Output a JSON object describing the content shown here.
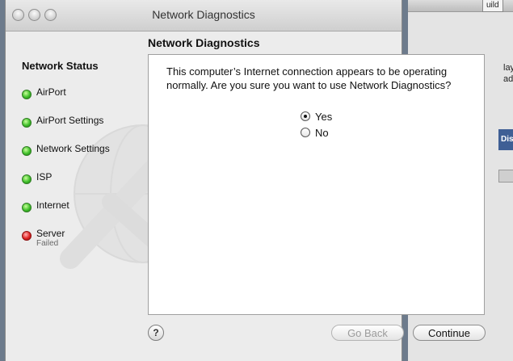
{
  "window": {
    "title": "Network Diagnostics"
  },
  "sidebar": {
    "heading": "Network Status",
    "items": [
      {
        "label": "AirPort",
        "status_color": "#3fbf2a",
        "sub": ""
      },
      {
        "label": "AirPort Settings",
        "status_color": "#3fbf2a",
        "sub": ""
      },
      {
        "label": "Network Settings",
        "status_color": "#3fbf2a",
        "sub": ""
      },
      {
        "label": "ISP",
        "status_color": "#3fbf2a",
        "sub": ""
      },
      {
        "label": "Internet",
        "status_color": "#3fbf2a",
        "sub": ""
      },
      {
        "label": "Server",
        "status_color": "#e02323",
        "sub": "Failed"
      }
    ]
  },
  "main": {
    "title": "Network Diagnostics",
    "question": "This computer’s Internet connection appears to be operating normally. Are you sure you want to use Network Diagnostics?",
    "options": [
      {
        "label": "Yes",
        "selected": true
      },
      {
        "label": "No",
        "selected": false
      }
    ]
  },
  "footer": {
    "help_label": "?",
    "back_label": "Go Back",
    "continue_label": "Continue"
  },
  "background_window": {
    "tab_text": "uild",
    "text_1": "lay",
    "text_2": "ad",
    "blue_label": "Dis"
  }
}
